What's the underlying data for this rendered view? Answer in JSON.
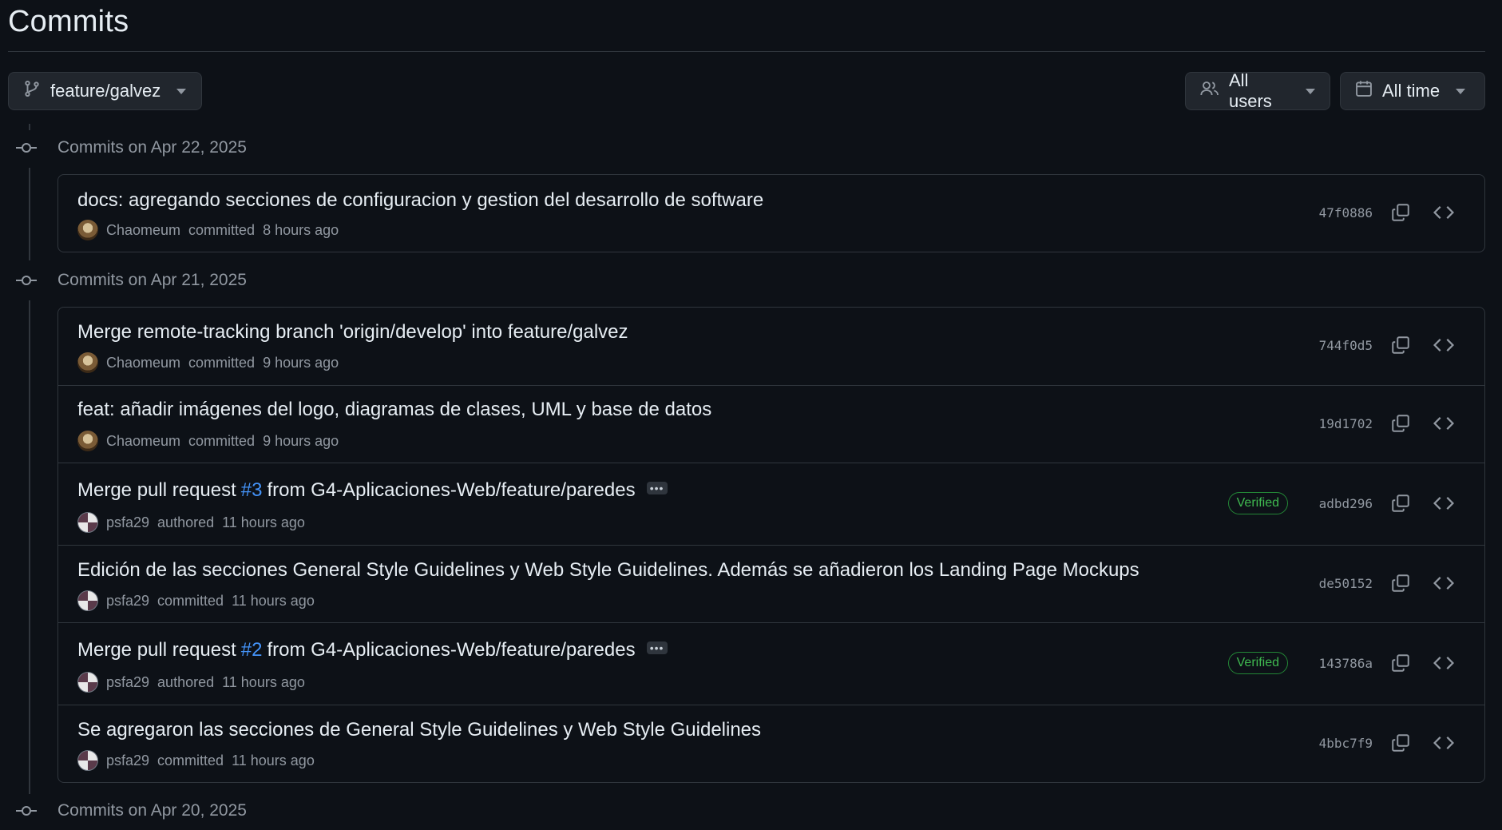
{
  "page": {
    "title": "Commits"
  },
  "filters": {
    "branch": "feature/galvez",
    "users": "All users",
    "time": "All time"
  },
  "colors": {
    "background": "#0d1117",
    "border": "#30363d",
    "link": "#4493f8",
    "verified": "#3fb950"
  },
  "days": [
    {
      "label": "Commits on Apr 22, 2025",
      "commits": [
        {
          "message": "docs: agregando secciones de configuracion y gestion del desarrollo de software",
          "author": "Chaomeum",
          "action": "committed",
          "time": "8 hours ago",
          "sha": "47f0886"
        }
      ]
    },
    {
      "label": "Commits on Apr 21, 2025",
      "commits": [
        {
          "message": "Merge remote-tracking branch 'origin/develop' into feature/galvez",
          "author": "Chaomeum",
          "action": "committed",
          "time": "9 hours ago",
          "sha": "744f0d5"
        },
        {
          "message": "feat: añadir imágenes del logo, diagramas de clases, UML y base de datos",
          "author": "Chaomeum",
          "action": "committed",
          "time": "9 hours ago",
          "sha": "19d1702"
        },
        {
          "message_pre": "Merge pull request",
          "pr": "#3",
          "message_post": "from G4-Aplicaciones-Web/feature/paredes",
          "author": "psfa29",
          "action": "authored",
          "time": "11 hours ago",
          "badge": "Verified",
          "sha": "adbd296"
        },
        {
          "message": "Edición de las secciones General Style Guidelines y Web Style Guidelines. Además se añadieron los Landing Page Mockups",
          "author": "psfa29",
          "action": "committed",
          "time": "11 hours ago",
          "sha": "de50152"
        },
        {
          "message_pre": "Merge pull request",
          "pr": "#2",
          "message_post": "from G4-Aplicaciones-Web/feature/paredes",
          "author": "psfa29",
          "action": "authored",
          "time": "11 hours ago",
          "badge": "Verified",
          "sha": "143786a"
        },
        {
          "message": "Se agregaron las secciones de General Style Guidelines y Web Style Guidelines",
          "author": "psfa29",
          "action": "committed",
          "time": "11 hours ago",
          "sha": "4bbc7f9"
        }
      ]
    },
    {
      "label": "Commits on Apr 20, 2025",
      "commits": []
    }
  ]
}
